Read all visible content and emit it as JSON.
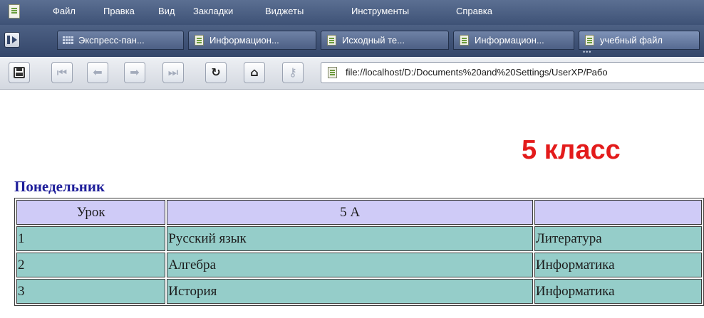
{
  "menu": {
    "items": [
      "Файл",
      "Правка",
      "Вид",
      "Закладки",
      "Виджеты",
      "Инструменты",
      "Справка"
    ]
  },
  "tabs": [
    {
      "label": "Экспресс-пан...",
      "icon": "speed-dial-icon"
    },
    {
      "label": "Информацион...",
      "icon": "page-icon"
    },
    {
      "label": "Исходный те...",
      "icon": "page-icon"
    },
    {
      "label": "Информацион...",
      "icon": "page-icon"
    },
    {
      "label": "учебный файл",
      "icon": "page-icon",
      "active": true
    }
  ],
  "toolbar": {
    "address": "file://localhost/D:/Documents%20and%20Settings/UserXP/Рабо"
  },
  "page": {
    "heading": "5 класс",
    "heading_color": "#e31b1b",
    "day": "Понедельник",
    "day_color": "#1e1e9a",
    "table": {
      "header": [
        "Урок",
        "5 А",
        ""
      ],
      "rows": [
        [
          "1",
          "Русский язык",
          "Литература"
        ],
        [
          "2",
          "Алгебра",
          "Информатика"
        ],
        [
          "3",
          "История",
          "Информатика"
        ]
      ],
      "header_bg": "#cfcbf7",
      "cell_bg": "#95cdc9"
    }
  }
}
